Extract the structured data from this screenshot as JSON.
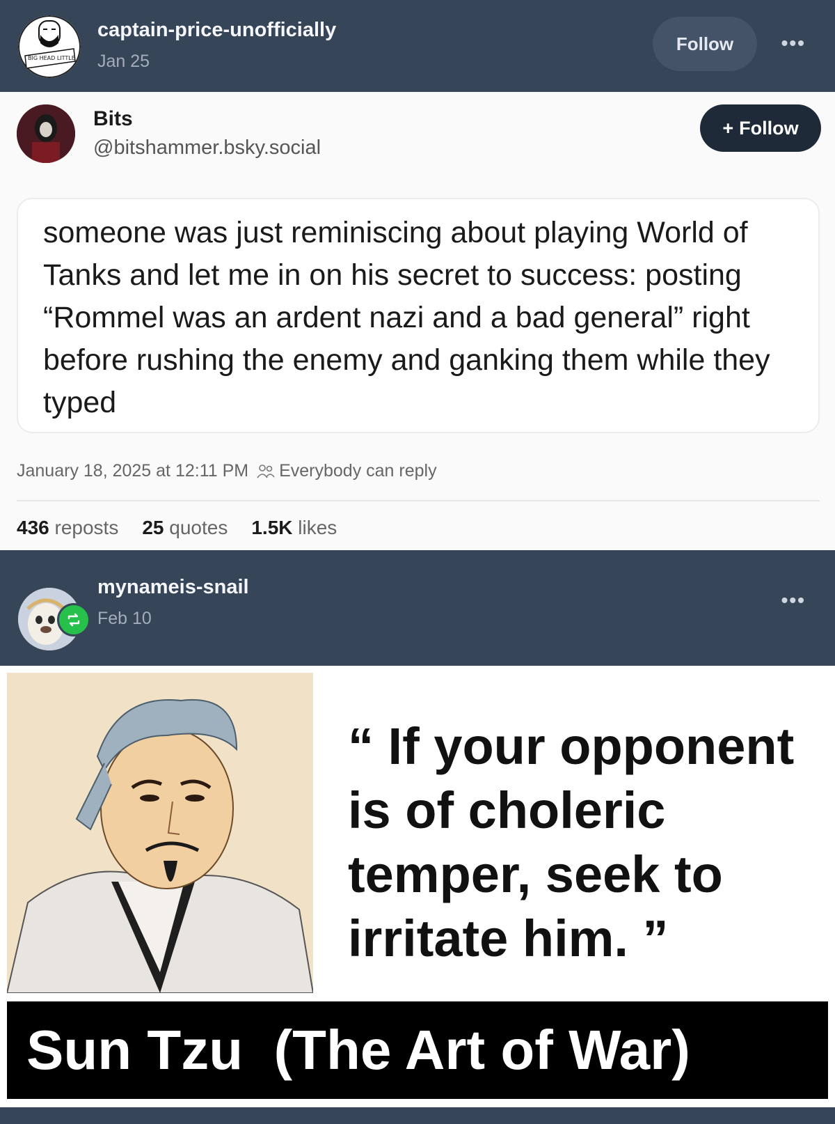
{
  "post1": {
    "username": "captain-price-unofficially",
    "date": "Jan 25",
    "follow_label": "Follow",
    "more_label": "•••",
    "avatar_text": "BIG HEAD LITTLE ARMS III"
  },
  "embedded_post": {
    "name": "Bits",
    "handle": "@bitshammer.bsky.social",
    "follow_label": "Follow",
    "follow_plus": "+",
    "text": "someone was just reminiscing about playing World of Tanks and let me in on his secret to success: posting “Rommel was an ardent nazi and a bad general” right before rushing the enemy and ganking them while they typed",
    "timestamp": "January 18, 2025 at 12:11 PM",
    "reply_setting": "Everybody can reply",
    "stats": {
      "reposts_count": "436",
      "reposts_label": "reposts",
      "quotes_count": "25",
      "quotes_label": "quotes",
      "likes_count": "1.5K",
      "likes_label": "likes"
    }
  },
  "post2": {
    "username": "mynameis-snail",
    "date": "Feb 10",
    "more_label": "•••",
    "reblog_icon": "reblog-icon"
  },
  "meme": {
    "quote": "“ If your opponent is of choleric temper, seek to irritate him. ”",
    "caption": "Sun Tzu  (The Art of War)"
  },
  "colors": {
    "background": "#374559",
    "follow_button": "#455369",
    "bsky_follow": "#1e2a38",
    "reblog_badge": "#27c04b"
  }
}
